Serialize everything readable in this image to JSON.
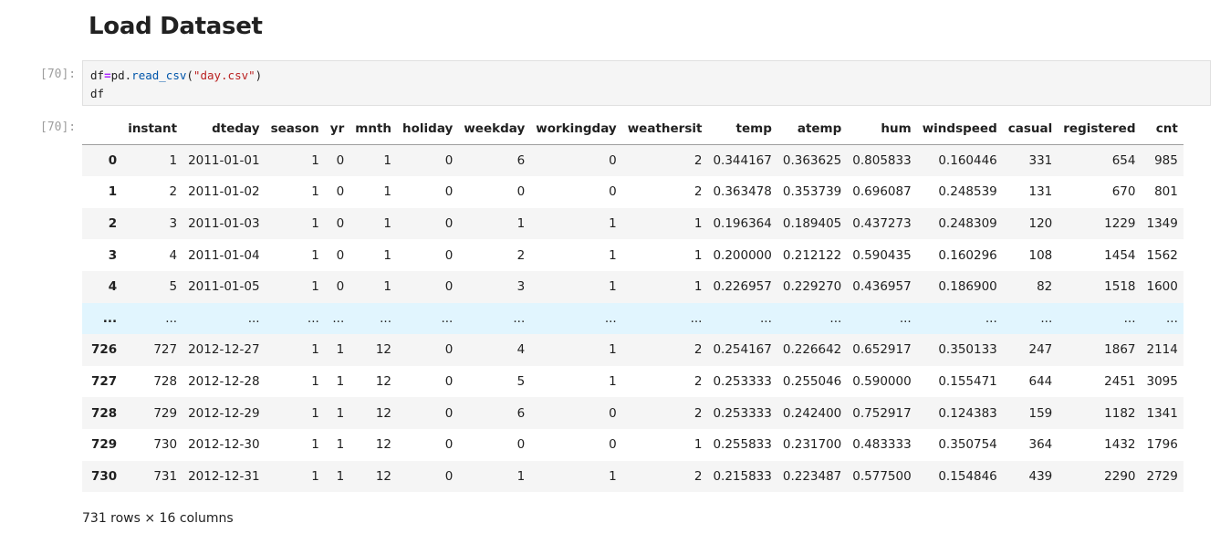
{
  "notebook": {
    "heading": "Load Dataset",
    "input_prompt": "[70]:",
    "output_prompt": "[70]:",
    "code": {
      "line1": {
        "var": "df",
        "op": "=",
        "mod": "pd.",
        "fn": "read_csv",
        "open": "(",
        "str": "\"day.csv\"",
        "close": ")"
      },
      "line2": "df"
    },
    "dataframe": {
      "columns": [
        "",
        "instant",
        "dteday",
        "season",
        "yr",
        "mnth",
        "holiday",
        "weekday",
        "workingday",
        "weathersit",
        "temp",
        "atemp",
        "hum",
        "windspeed",
        "casual",
        "registered",
        "cnt"
      ],
      "rows": [
        [
          "0",
          "1",
          "2011-01-01",
          "1",
          "0",
          "1",
          "0",
          "6",
          "0",
          "2",
          "0.344167",
          "0.363625",
          "0.805833",
          "0.160446",
          "331",
          "654",
          "985"
        ],
        [
          "1",
          "2",
          "2011-01-02",
          "1",
          "0",
          "1",
          "0",
          "0",
          "0",
          "2",
          "0.363478",
          "0.353739",
          "0.696087",
          "0.248539",
          "131",
          "670",
          "801"
        ],
        [
          "2",
          "3",
          "2011-01-03",
          "1",
          "0",
          "1",
          "0",
          "1",
          "1",
          "1",
          "0.196364",
          "0.189405",
          "0.437273",
          "0.248309",
          "120",
          "1229",
          "1349"
        ],
        [
          "3",
          "4",
          "2011-01-04",
          "1",
          "0",
          "1",
          "0",
          "2",
          "1",
          "1",
          "0.200000",
          "0.212122",
          "0.590435",
          "0.160296",
          "108",
          "1454",
          "1562"
        ],
        [
          "4",
          "5",
          "2011-01-05",
          "1",
          "0",
          "1",
          "0",
          "3",
          "1",
          "1",
          "0.226957",
          "0.229270",
          "0.436957",
          "0.186900",
          "82",
          "1518",
          "1600"
        ],
        [
          "...",
          "...",
          "...",
          "...",
          "...",
          "...",
          "...",
          "...",
          "...",
          "...",
          "...",
          "...",
          "...",
          "...",
          "...",
          "...",
          "..."
        ],
        [
          "726",
          "727",
          "2012-12-27",
          "1",
          "1",
          "12",
          "0",
          "4",
          "1",
          "2",
          "0.254167",
          "0.226642",
          "0.652917",
          "0.350133",
          "247",
          "1867",
          "2114"
        ],
        [
          "727",
          "728",
          "2012-12-28",
          "1",
          "1",
          "12",
          "0",
          "5",
          "1",
          "2",
          "0.253333",
          "0.255046",
          "0.590000",
          "0.155471",
          "644",
          "2451",
          "3095"
        ],
        [
          "728",
          "729",
          "2012-12-29",
          "1",
          "1",
          "12",
          "0",
          "6",
          "0",
          "2",
          "0.253333",
          "0.242400",
          "0.752917",
          "0.124383",
          "159",
          "1182",
          "1341"
        ],
        [
          "729",
          "730",
          "2012-12-30",
          "1",
          "1",
          "12",
          "0",
          "0",
          "0",
          "1",
          "0.255833",
          "0.231700",
          "0.483333",
          "0.350754",
          "364",
          "1432",
          "1796"
        ],
        [
          "730",
          "731",
          "2012-12-31",
          "1",
          "1",
          "12",
          "0",
          "1",
          "1",
          "2",
          "0.215833",
          "0.223487",
          "0.577500",
          "0.154846",
          "439",
          "2290",
          "2729"
        ]
      ],
      "shape_text": "731 rows × 16 columns"
    }
  }
}
